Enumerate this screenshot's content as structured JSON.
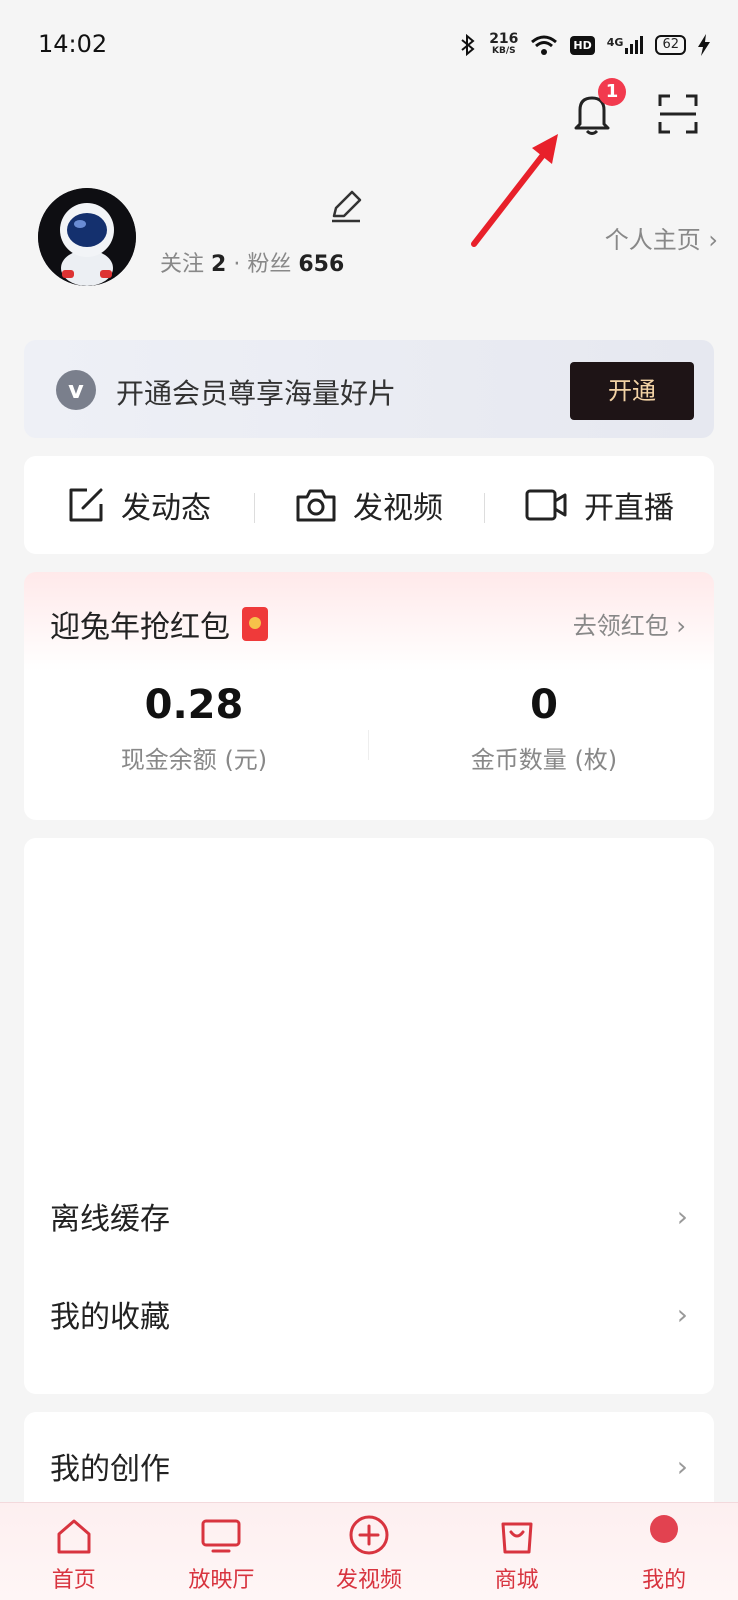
{
  "status_bar": {
    "time": "14:02",
    "speed": "216",
    "speed_unit": "KB/S",
    "hd": "HD",
    "net": "4G",
    "battery": "62"
  },
  "notification": {
    "count": "1"
  },
  "profile": {
    "follow_label": "关注",
    "follow_count": "2",
    "separator": "·",
    "fans_label": "粉丝",
    "fans_count": "656",
    "home_link": "个人主页 ›"
  },
  "vip": {
    "logo": "v",
    "text": "开通会员尊享海量好片",
    "button": "开通"
  },
  "actions": [
    {
      "label": "发动态",
      "icon": "edit-square-icon"
    },
    {
      "label": "发视频",
      "icon": "camera-icon"
    },
    {
      "label": "开直播",
      "icon": "video-camera-icon"
    }
  ],
  "redpack": {
    "title": "迎兔年抢红包",
    "link": "去领红包 ›",
    "cash_value": "0.28",
    "cash_label": "现金余额 (元)",
    "coin_value": "0",
    "coin_label": "金币数量 (枚)"
  },
  "menu": {
    "offline": "离线缓存",
    "favorites": "我的收藏",
    "creation": "我的创作",
    "chevron": "›"
  },
  "tabs": [
    {
      "label": "首页",
      "icon": "home-icon"
    },
    {
      "label": "放映厅",
      "icon": "tv-icon"
    },
    {
      "label": "发视频",
      "icon": "plus-circle-icon"
    },
    {
      "label": "商城",
      "icon": "shopping-bag-icon"
    },
    {
      "label": "我的",
      "icon": "profile-icon"
    }
  ],
  "colors": {
    "accent": "#d8343f",
    "badge": "#f23a4e",
    "vip_button_bg": "#1e1416",
    "vip_button_text": "#f3d3a5"
  }
}
